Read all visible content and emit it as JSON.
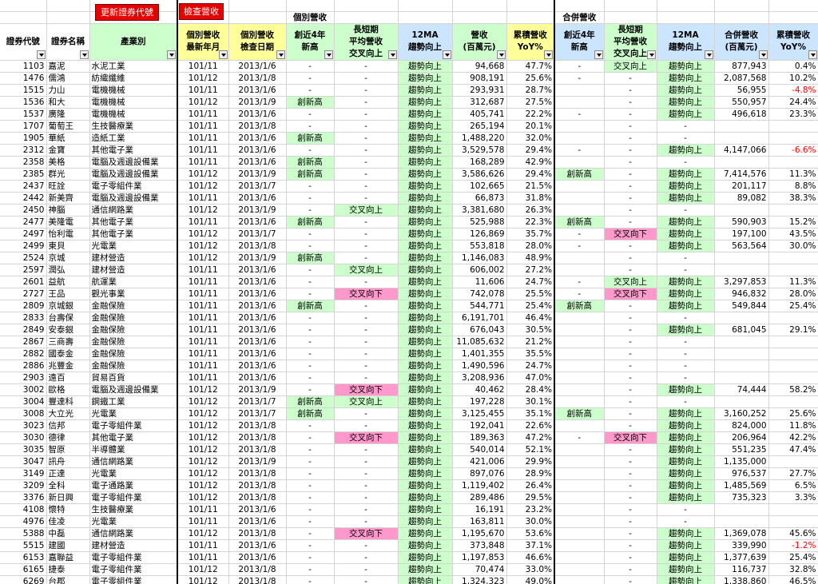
{
  "buttons": {
    "update_codes": "更新證券代號",
    "check_revenue": "檢查營收"
  },
  "groups": {
    "individual": "個別營收",
    "consolidated": "合併營收"
  },
  "headers": [
    [
      "證券代號"
    ],
    [
      "證券名稱"
    ],
    [
      "產業別"
    ],
    [
      "個別營收",
      "最新年月"
    ],
    [
      "個別營收",
      "檢查日期"
    ],
    [
      "創近4年",
      "新高"
    ],
    [
      "長短期",
      "平均營收",
      "交叉向上"
    ],
    [
      "12MA",
      "趨勢向上"
    ],
    [
      "營收",
      "(百萬元)"
    ],
    [
      "累積營收",
      "YoY%"
    ],
    [
      "創近4年",
      "新高"
    ],
    [
      "長短期",
      "平均營收",
      "交叉向上"
    ],
    [
      "12MA",
      "趨勢向上"
    ],
    [
      "合併營收",
      "(百萬元)"
    ],
    [
      "累積營收",
      "YoY%"
    ]
  ],
  "rows": [
    [
      "1103",
      "嘉泥",
      "水泥工業",
      "101/11",
      "2013/1/6",
      "-",
      "-",
      "趨勢向上",
      "94,668",
      "47.7%",
      "-",
      "交叉向上",
      "趨勢向上",
      "877,943",
      "0.4%"
    ],
    [
      "1476",
      "儒鴻",
      "紡織纖維",
      "101/12",
      "2013/1/8",
      "-",
      "-",
      "趨勢向上",
      "908,191",
      "25.6%",
      "-",
      "-",
      "趨勢向上",
      "2,087,568",
      "10.2%"
    ],
    [
      "1515",
      "力山",
      "電機機械",
      "101/11",
      "2013/1/6",
      "-",
      "-",
      "趨勢向上",
      "293,931",
      "28.7%",
      "",
      "-",
      "趨勢向上",
      "56,955",
      "-4.8%"
    ],
    [
      "1536",
      "和大",
      "電機機械",
      "101/12",
      "2013/1/9",
      "創新高",
      "-",
      "趨勢向上",
      "312,687",
      "27.5%",
      "",
      "-",
      "趨勢向上",
      "550,957",
      "24.4%"
    ],
    [
      "1537",
      "廣隆",
      "電機機械",
      "101/11",
      "2013/1/6",
      "-",
      "-",
      "趨勢向上",
      "405,741",
      "22.2%",
      "-",
      "-",
      "趨勢向上",
      "496,618",
      "23.3%"
    ],
    [
      "1707",
      "葡萄王",
      "生技醫療業",
      "101/11",
      "2013/1/8",
      "-",
      "-",
      "趨勢向上",
      "265,194",
      "20.1%",
      "",
      "-",
      "-",
      "",
      ""
    ],
    [
      "1905",
      "華紙",
      "造紙工業",
      "101/11",
      "2013/1/6",
      "創新高",
      "-",
      "趨勢向上",
      "1,488,220",
      "32.0%",
      "",
      "-",
      "-",
      "",
      ""
    ],
    [
      "2312",
      "金寶",
      "其他電子業",
      "101/11",
      "2013/1/6",
      "-",
      "-",
      "趨勢向上",
      "3,529,578",
      "29.4%",
      "-",
      "-",
      "趨勢向上",
      "4,147,066",
      "-6.6%"
    ],
    [
      "2358",
      "美格",
      "電腦及週邊設備業",
      "101/11",
      "2013/1/6",
      "創新高",
      "-",
      "趨勢向上",
      "168,289",
      "42.9%",
      "",
      "-",
      "-",
      "",
      ""
    ],
    [
      "2385",
      "群光",
      "電腦及週邊設備業",
      "101/12",
      "2013/1/9",
      "創新高",
      "-",
      "趨勢向上",
      "3,586,626",
      "29.4%",
      "創新高",
      "-",
      "趨勢向上",
      "7,414,576",
      "11.3%"
    ],
    [
      "2437",
      "旺詮",
      "電子零組件業",
      "101/12",
      "2013/1/7",
      "-",
      "-",
      "趨勢向上",
      "102,665",
      "21.5%",
      "",
      "-",
      "趨勢向上",
      "201,117",
      "8.8%"
    ],
    [
      "2442",
      "新美齊",
      "電腦及週邊設備業",
      "101/11",
      "2013/1/6",
      "-",
      "-",
      "趨勢向上",
      "66,873",
      "31.8%",
      "",
      "-",
      "趨勢向上",
      "89,082",
      "38.3%"
    ],
    [
      "2450",
      "神腦",
      "通信網路業",
      "101/12",
      "2013/1/9",
      "-",
      "交叉向上",
      "趨勢向上",
      "3,381,680",
      "26.3%",
      "",
      "-",
      "-",
      "",
      ""
    ],
    [
      "2477",
      "美隆電",
      "其他電子業",
      "101/11",
      "2013/1/6",
      "創新高",
      "-",
      "趨勢向上",
      "525,988",
      "22.3%",
      "創新高",
      "-",
      "趨勢向上",
      "590,903",
      "15.2%"
    ],
    [
      "2497",
      "怡利電",
      "其他電子業",
      "101/12",
      "2013/1/7",
      "-",
      "-",
      "趨勢向上",
      "126,869",
      "35.7%",
      "-",
      "交叉向下",
      "趨勢向上",
      "197,100",
      "43.5%"
    ],
    [
      "2499",
      "東貝",
      "光電業",
      "101/12",
      "2013/1/8",
      "-",
      "-",
      "趨勢向上",
      "553,818",
      "28.0%",
      "-",
      "-",
      "趨勢向上",
      "563,564",
      "30.0%"
    ],
    [
      "2524",
      "京城",
      "建材營造",
      "101/12",
      "2013/1/9",
      "創新高",
      "-",
      "趨勢向上",
      "1,146,083",
      "48.9%",
      "",
      "-",
      "-",
      "",
      ""
    ],
    [
      "2597",
      "潤弘",
      "建材營造",
      "101/11",
      "2013/1/6",
      "-",
      "交叉向上",
      "趨勢向上",
      "606,002",
      "27.2%",
      "",
      "-",
      "-",
      "",
      ""
    ],
    [
      "2601",
      "益航",
      "航運業",
      "101/11",
      "2013/1/6",
      "-",
      "-",
      "趨勢向上",
      "11,606",
      "24.7%",
      "-",
      "交叉向上",
      "趨勢向上",
      "3,297,853",
      "11.3%"
    ],
    [
      "2727",
      "王品",
      "觀光事業",
      "101/11",
      "2013/1/6",
      "-",
      "交叉向下",
      "趨勢向上",
      "742,078",
      "25.5%",
      "-",
      "交叉向下",
      "趨勢向上",
      "946,832",
      "28.0%"
    ],
    [
      "2809",
      "京城銀",
      "金融保險",
      "101/11",
      "2013/1/6",
      "創新高",
      "-",
      "趨勢向上",
      "544,771",
      "25.4%",
      "創新高",
      "-",
      "趨勢向上",
      "549,844",
      "25.4%"
    ],
    [
      "2833",
      "台壽保",
      "金融保險",
      "101/11",
      "2013/1/6",
      "-",
      "-",
      "趨勢向上",
      "6,191,701",
      "46.4%",
      "",
      "-",
      "-",
      "",
      ""
    ],
    [
      "2849",
      "安泰銀",
      "金融保險",
      "101/11",
      "2013/1/6",
      "-",
      "-",
      "趨勢向上",
      "676,043",
      "30.5%",
      "",
      "-",
      "趨勢向上",
      "681,045",
      "29.1%"
    ],
    [
      "2867",
      "三商壽",
      "金融保險",
      "101/11",
      "2013/1/6",
      "-",
      "-",
      "趨勢向上",
      "11,085,632",
      "21.2%",
      "",
      "-",
      "-",
      "",
      ""
    ],
    [
      "2882",
      "國泰金",
      "金融保險",
      "101/11",
      "2013/1/6",
      "-",
      "-",
      "趨勢向上",
      "1,401,355",
      "35.5%",
      "",
      "-",
      "-",
      "",
      ""
    ],
    [
      "2886",
      "兆豐金",
      "金融保險",
      "101/11",
      "2013/1/6",
      "-",
      "-",
      "趨勢向上",
      "1,490,596",
      "24.7%",
      "",
      "-",
      "-",
      "",
      ""
    ],
    [
      "2903",
      "遠百",
      "貿易百貨",
      "101/11",
      "2013/1/6",
      "-",
      "-",
      "趨勢向上",
      "3,208,936",
      "47.0%",
      "",
      "-",
      "-",
      "",
      ""
    ],
    [
      "3002",
      "歐格",
      "電腦及週邊設備業",
      "101/12",
      "2013/1/9",
      "-",
      "交叉向下",
      "趨勢向上",
      "40,462",
      "28.4%",
      "",
      "-",
      "趨勢向上",
      "74,444",
      "58.2%"
    ],
    [
      "3004",
      "豐達科",
      "鋼鐵工業",
      "101/12",
      "2013/1/7",
      "創新高",
      "交叉向上",
      "趨勢向上",
      "197,228",
      "30.1%",
      "",
      "-",
      "-",
      "",
      ""
    ],
    [
      "3008",
      "大立光",
      "光電業",
      "101/12",
      "2013/1/7",
      "創新高",
      "-",
      "趨勢向上",
      "3,125,455",
      "35.1%",
      "創新高",
      "-",
      "趨勢向上",
      "3,160,252",
      "25.6%"
    ],
    [
      "3023",
      "信邦",
      "電子零組件業",
      "101/12",
      "2013/1/8",
      "-",
      "-",
      "趨勢向上",
      "192,041",
      "22.6%",
      "",
      "-",
      "趨勢向上",
      "824,000",
      "11.8%"
    ],
    [
      "3030",
      "德律",
      "其他電子業",
      "101/12",
      "2013/1/8",
      "-",
      "交叉向下",
      "趨勢向上",
      "189,363",
      "47.2%",
      "-",
      "交叉向下",
      "趨勢向上",
      "206,964",
      "42.2%"
    ],
    [
      "3035",
      "智原",
      "半導體業",
      "101/12",
      "2013/1/8",
      "-",
      "-",
      "趨勢向上",
      "540,014",
      "52.1%",
      "",
      "-",
      "趨勢向上",
      "551,235",
      "47.4%"
    ],
    [
      "3047",
      "訊舟",
      "通信網路業",
      "101/12",
      "2013/1/9",
      "-",
      "-",
      "趨勢向上",
      "421,006",
      "29.9%",
      "",
      "-",
      "趨勢向上",
      "1,135,000",
      ""
    ],
    [
      "3149",
      "正達",
      "光電業",
      "101/12",
      "2013/1/8",
      "-",
      "-",
      "趨勢向上",
      "897,076",
      "28.9%",
      "",
      "-",
      "趨勢向上",
      "976,537",
      "27.7%"
    ],
    [
      "3209",
      "全科",
      "電子通路業",
      "101/12",
      "2013/1/8",
      "-",
      "-",
      "趨勢向上",
      "1,119,402",
      "26.4%",
      "",
      "-",
      "趨勢向上",
      "1,485,569",
      "6.5%"
    ],
    [
      "3376",
      "新日興",
      "電子零組件業",
      "101/12",
      "2013/1/8",
      "-",
      "-",
      "趨勢向上",
      "289,486",
      "29.5%",
      "",
      "-",
      "趨勢向上",
      "735,323",
      "3.3%"
    ],
    [
      "4108",
      "懷特",
      "生技醫療業",
      "101/11",
      "2013/1/6",
      "-",
      "-",
      "趨勢向上",
      "16,191",
      "23.2%",
      "",
      "-",
      "-",
      "",
      ""
    ],
    [
      "4976",
      "佳凌",
      "光電業",
      "101/11",
      "2013/1/6",
      "-",
      "-",
      "趨勢向上",
      "163,811",
      "30.0%",
      "",
      "-",
      "-",
      "",
      ""
    ],
    [
      "5388",
      "中磊",
      "通信網路業",
      "101/12",
      "2013/1/8",
      "-",
      "交叉向下",
      "趨勢向上",
      "1,195,670",
      "53.6%",
      "",
      "-",
      "趨勢向上",
      "1,369,078",
      "45.6%"
    ],
    [
      "5515",
      "建國",
      "建材營造",
      "101/11",
      "2013/1/6",
      "-",
      "-",
      "趨勢向上",
      "373,848",
      "37.1%",
      "",
      "-",
      "趨勢向上",
      "339,990",
      "-1.2%"
    ],
    [
      "6153",
      "嘉聯益",
      "電子零組件業",
      "101/11",
      "2013/1/6",
      "-",
      "-",
      "趨勢向上",
      "1,197,853",
      "46.6%",
      "",
      "-",
      "趨勢向上",
      "1,377,639",
      "25.4%"
    ],
    [
      "6165",
      "捷泰",
      "電子零組件業",
      "101/12",
      "2013/1/8",
      "-",
      "-",
      "趨勢向上",
      "70,474",
      "33.0%",
      "",
      "-",
      "趨勢向上",
      "116,737",
      "32.8%"
    ],
    [
      "6269",
      "台郡",
      "電子零組件業",
      "101/12",
      "2013/1/8",
      "-",
      "-",
      "趨勢向上",
      "1,324,323",
      "49.0%",
      "",
      "-",
      "趨勢向上",
      "1,338,860",
      "46.5%"
    ]
  ],
  "colors": {
    "header_yellow": "#ffff99",
    "header_green": "#ccffcc",
    "header_blue": "#cce5ff",
    "cell_green": "#ccffcc",
    "cell_pink": "#ff99cc",
    "negative": "#ff0000",
    "button_red": "#e60000"
  }
}
